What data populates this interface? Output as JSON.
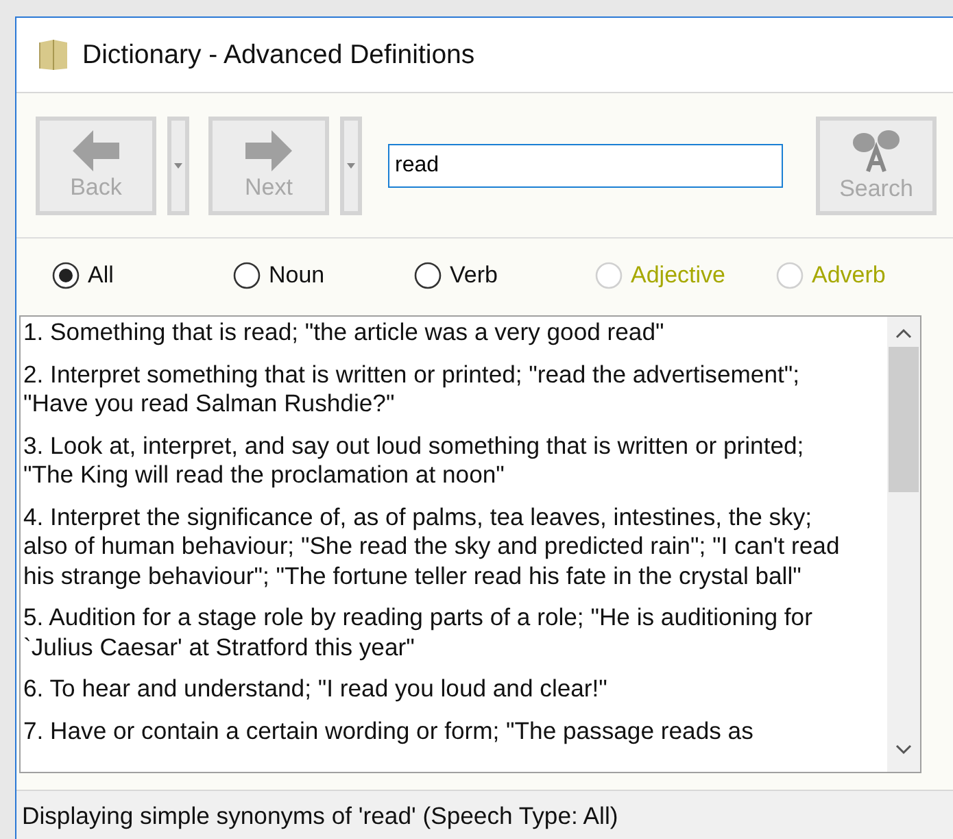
{
  "window": {
    "title": "Dictionary - Advanced Definitions"
  },
  "toolbar": {
    "buttons": [
      {
        "kind": "back",
        "label": "Back",
        "disabled": true,
        "has_dropdown": true
      },
      {
        "kind": "next",
        "label": "Next",
        "disabled": true,
        "has_dropdown": true
      }
    ],
    "search_field": {
      "value": "read"
    },
    "search_button": {
      "label": "Search",
      "disabled": true
    }
  },
  "speech_types": [
    {
      "label": "All",
      "selected": true,
      "disabled": false
    },
    {
      "label": "Noun",
      "selected": false,
      "disabled": false
    },
    {
      "label": "Verb",
      "selected": false,
      "disabled": false
    },
    {
      "label": "Adjective",
      "selected": false,
      "disabled": true
    },
    {
      "label": "Adverb",
      "selected": false,
      "disabled": true
    }
  ],
  "definitions": [
    [
      "1. Something that is read; \"the article was a very good read\""
    ],
    [
      "2. Interpret something that is written or printed; \"read the advertisement\";",
      "\"Have you read Salman Rushdie?\""
    ],
    [
      "3. Look at, interpret, and say out loud something that is written or printed;",
      "\"The King will read the proclamation at noon\""
    ],
    [
      "4. Interpret the significance of, as of palms, tea leaves, intestines, the sky;",
      "also of human behaviour; \"She read the sky and predicted rain\"; \"I can't read",
      "his strange behaviour\"; \"The fortune teller read his fate in the crystal ball\""
    ],
    [
      "5. Audition for a stage role by reading parts of a role; \"He is auditioning for",
      "`Julius Caesar' at Stratford this year\""
    ],
    [
      "6. To hear and understand; \"I read you loud and clear!\""
    ],
    [
      "7. Have or contain a certain wording or form; \"The passage reads as"
    ]
  ],
  "status_bar": "Displaying simple synonyms of 'read' (Speech Type: All)"
}
